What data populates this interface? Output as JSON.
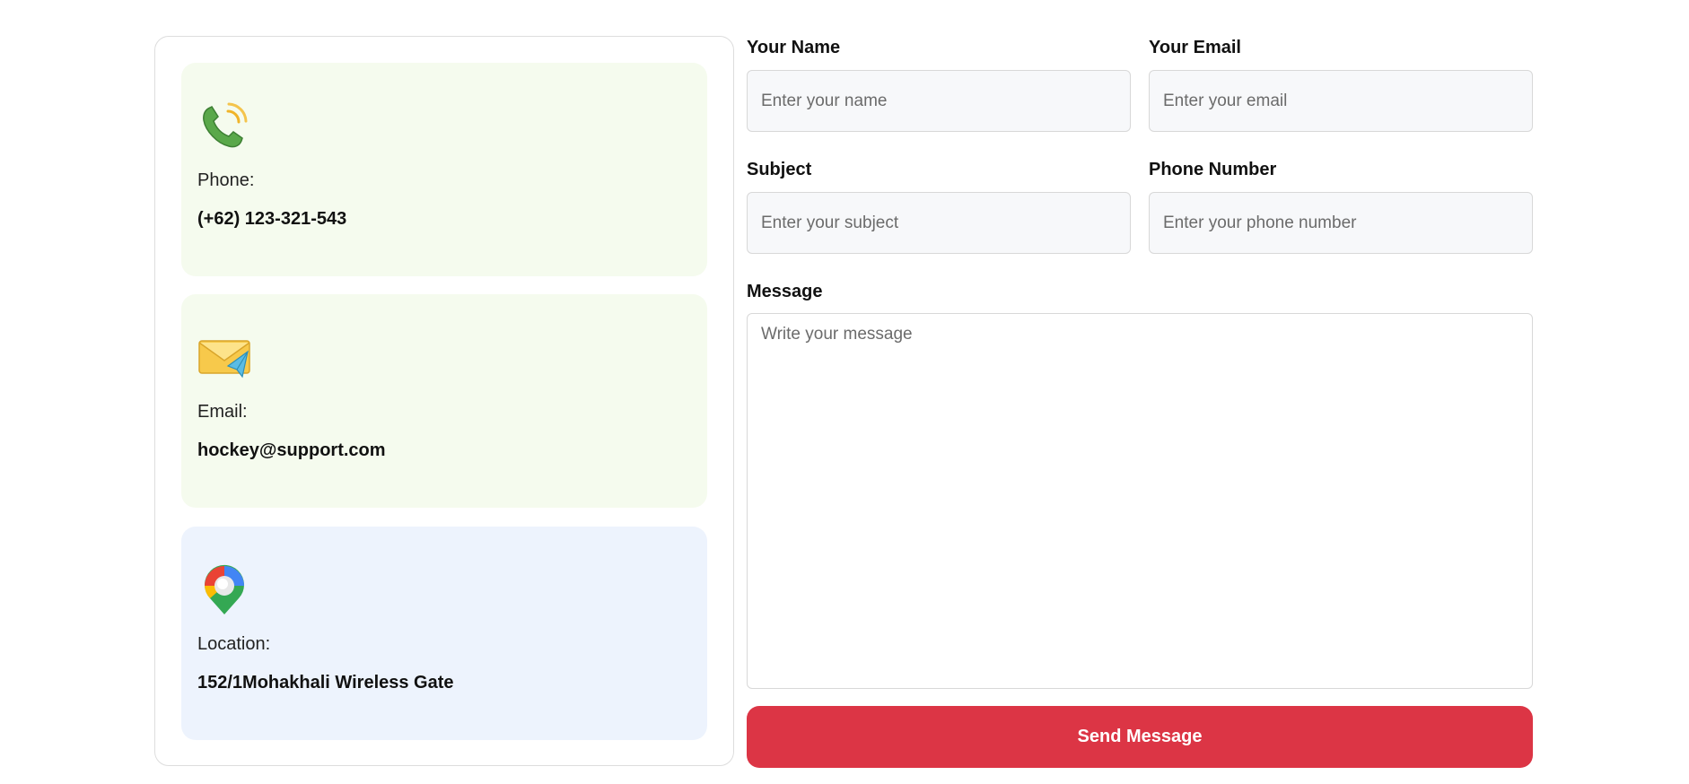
{
  "contact_info": {
    "phone": {
      "icon": "phone-ringing-icon",
      "label": "Phone:",
      "value": "(+62) 123-321-543"
    },
    "email": {
      "icon": "envelope-paper-plane-icon",
      "label": "Email:",
      "value": "hockey@support.com"
    },
    "location": {
      "icon": "map-pin-icon",
      "label": "Location:",
      "value": "152/1Mohakhali Wireless Gate"
    }
  },
  "form": {
    "name": {
      "label": "Your Name",
      "placeholder": "Enter your name",
      "value": ""
    },
    "email": {
      "label": "Your Email",
      "placeholder": "Enter your email",
      "value": ""
    },
    "subject": {
      "label": "Subject",
      "placeholder": "Enter your subject",
      "value": ""
    },
    "phone": {
      "label": "Phone Number",
      "placeholder": "Enter your phone number",
      "value": ""
    },
    "message": {
      "label": "Message",
      "placeholder": "Write your message",
      "value": ""
    },
    "submit_label": "Send Message"
  },
  "colors": {
    "accent": "#dc3545",
    "card_green": "#f5fbee",
    "card_blue": "#edf3fd"
  }
}
